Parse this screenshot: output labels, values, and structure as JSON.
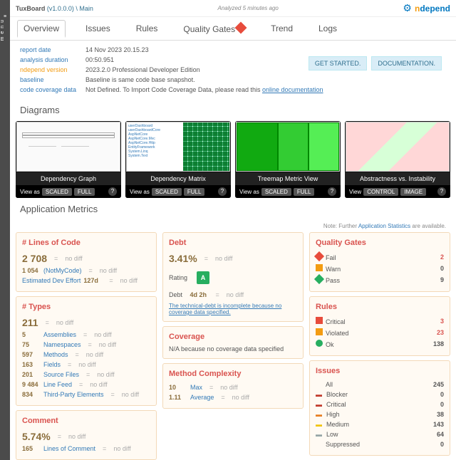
{
  "topbar": {
    "product": "TuxBoard",
    "version": "(v1.0.0.0)",
    "crumb": "Main",
    "analyzed": "Analyzed 5 minutes ago",
    "brand_n": "n",
    "brand_d": "depend"
  },
  "tabs": {
    "overview": "Overview",
    "issues": "Issues",
    "rules": "Rules",
    "qg": "Quality Gates",
    "trend": "Trend",
    "logs": "Logs"
  },
  "buttons": {
    "getstarted": "GET STARTED.",
    "docs": "DOCUMENTATION."
  },
  "info": {
    "report_date_k": "report date",
    "report_date_v": "14 Nov 2023 20.15.23",
    "duration_k": "analysis duration",
    "duration_v": "00:50.951",
    "ver_k": "ndepend version",
    "ver_v": "2023.2.0   Professional Developer Edition",
    "baseline_k": "baseline",
    "baseline_v": "Baseline is same code base snapshot.",
    "cov_k": "code coverage data",
    "cov_v1": "Not Defined. To Import Code Coverage Data, please read this ",
    "cov_link": "online documentation"
  },
  "diagrams": {
    "heading": "Diagrams",
    "cards": [
      {
        "title": "Dependency Graph",
        "viewas": "View as",
        "b1": "SCALED",
        "b2": "FULL"
      },
      {
        "title": "Dependency Matrix",
        "viewas": "View as",
        "b1": "SCALED",
        "b2": "FULL"
      },
      {
        "title": "Treemap Metric View",
        "viewas": "View as",
        "b1": "SCALED",
        "b2": "FULL"
      },
      {
        "title": "Abstractness vs. Instability",
        "viewas": "View",
        "b1": "CONTROL",
        "b2": "IMAGE"
      }
    ]
  },
  "metrics": {
    "heading": "Application Metrics",
    "note_pre": "Note: Further ",
    "note_link": "Application Statistics",
    "note_post": " are available.",
    "loc": {
      "title": "# Lines of Code",
      "value": "2 708",
      "nodiff": "no diff",
      "notmycode_n": "1 054",
      "notmycode_l": "(NotMyCode)",
      "eff_l": "Estimated Dev Effort",
      "eff_v": "127d"
    },
    "types": {
      "title": "# Types",
      "value": "211",
      "nodiff": "no diff",
      "rows": [
        {
          "n": "5",
          "l": "Assemblies"
        },
        {
          "n": "75",
          "l": "Namespaces"
        },
        {
          "n": "597",
          "l": "Methods"
        },
        {
          "n": "163",
          "l": "Fields"
        },
        {
          "n": "201",
          "l": "Source Files"
        },
        {
          "n": "9 484",
          "l": "Line Feed"
        },
        {
          "n": "834",
          "l": "Third-Party Elements"
        }
      ]
    },
    "comment": {
      "title": "Comment",
      "value": "5.74%",
      "nodiff": "no diff",
      "n": "165",
      "l": "Lines of Comment"
    },
    "debt": {
      "title": "Debt",
      "value": "3.41%",
      "nodiff": "no diff",
      "rating_l": "Rating",
      "rating": "A",
      "debt_l": "Debt",
      "debt_v": "4d 2h",
      "inc": "The technical-debt is incomplete because no coverage data specified."
    },
    "coverage": {
      "title": "Coverage",
      "msg": "N/A because no coverage data specified"
    },
    "complexity": {
      "title": "Method Complexity",
      "max_n": "10",
      "max_l": "Max",
      "avg_n": "1.11",
      "avg_l": "Average",
      "nodiff": "no diff"
    },
    "qg": {
      "title": "Quality Gates",
      "fail_l": "Fail",
      "fail_n": "2",
      "warn_l": "Warn",
      "warn_n": "0",
      "pass_l": "Pass",
      "pass_n": "9"
    },
    "rules": {
      "title": "Rules",
      "crit_l": "Critical",
      "crit_n": "3",
      "viol_l": "Violated",
      "viol_n": "23",
      "ok_l": "Ok",
      "ok_n": "138"
    },
    "issues": {
      "title": "Issues",
      "all_l": "All",
      "all_n": "245",
      "rows": [
        {
          "l": "Blocker",
          "n": "0",
          "cls": "sev-blocker"
        },
        {
          "l": "Critical",
          "n": "0",
          "cls": "sev-critical"
        },
        {
          "l": "High",
          "n": "38",
          "cls": "sev-high"
        },
        {
          "l": "Medium",
          "n": "143",
          "cls": "sev-medium"
        },
        {
          "l": "Low",
          "n": "64",
          "cls": "sev-low"
        }
      ],
      "sup_l": "Suppressed",
      "sup_n": "0"
    }
  },
  "menulabel": "m e n u"
}
